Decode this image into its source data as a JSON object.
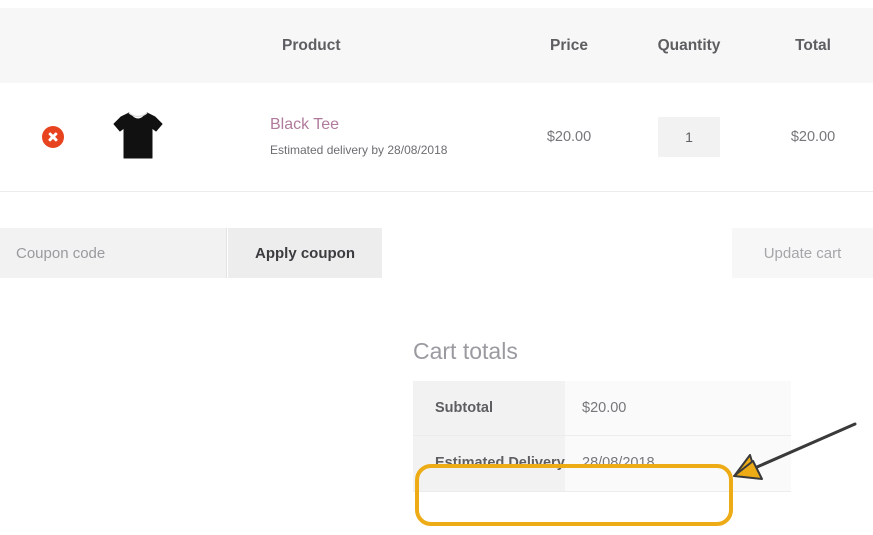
{
  "cart_table": {
    "headers": {
      "remove": "",
      "thumbnail": "",
      "product": "Product",
      "price": "Price",
      "quantity": "Quantity",
      "total": "Total"
    },
    "rows": [
      {
        "remove_icon": "remove-circle-icon",
        "thumbnail_icon": "black-tshirt-thumbnail",
        "name": "Black Tee",
        "meta": "Estimated delivery by 28/08/2018",
        "price": "$20.00",
        "quantity": "1",
        "total": "$20.00"
      }
    ]
  },
  "coupon": {
    "placeholder": "Coupon code",
    "value": "",
    "apply_label": "Apply coupon",
    "update_label": "Update cart"
  },
  "cart_totals": {
    "title": "Cart totals",
    "rows": [
      {
        "label": "Subtotal",
        "value": "$20.00"
      },
      {
        "label": "Estimated Delivery",
        "value": "28/08/2018"
      }
    ]
  },
  "annotations": {
    "highlight_color": "#edab16",
    "arrow_color": "#edab16",
    "arrow_outline_color": "#3a3a3a",
    "highlight_target": "Estimated Delivery"
  },
  "colors": {
    "header_background": "#f7f7f7",
    "product_link": "#b07a9c",
    "remove_button": "#e8431f",
    "text": "#5e5e62"
  }
}
